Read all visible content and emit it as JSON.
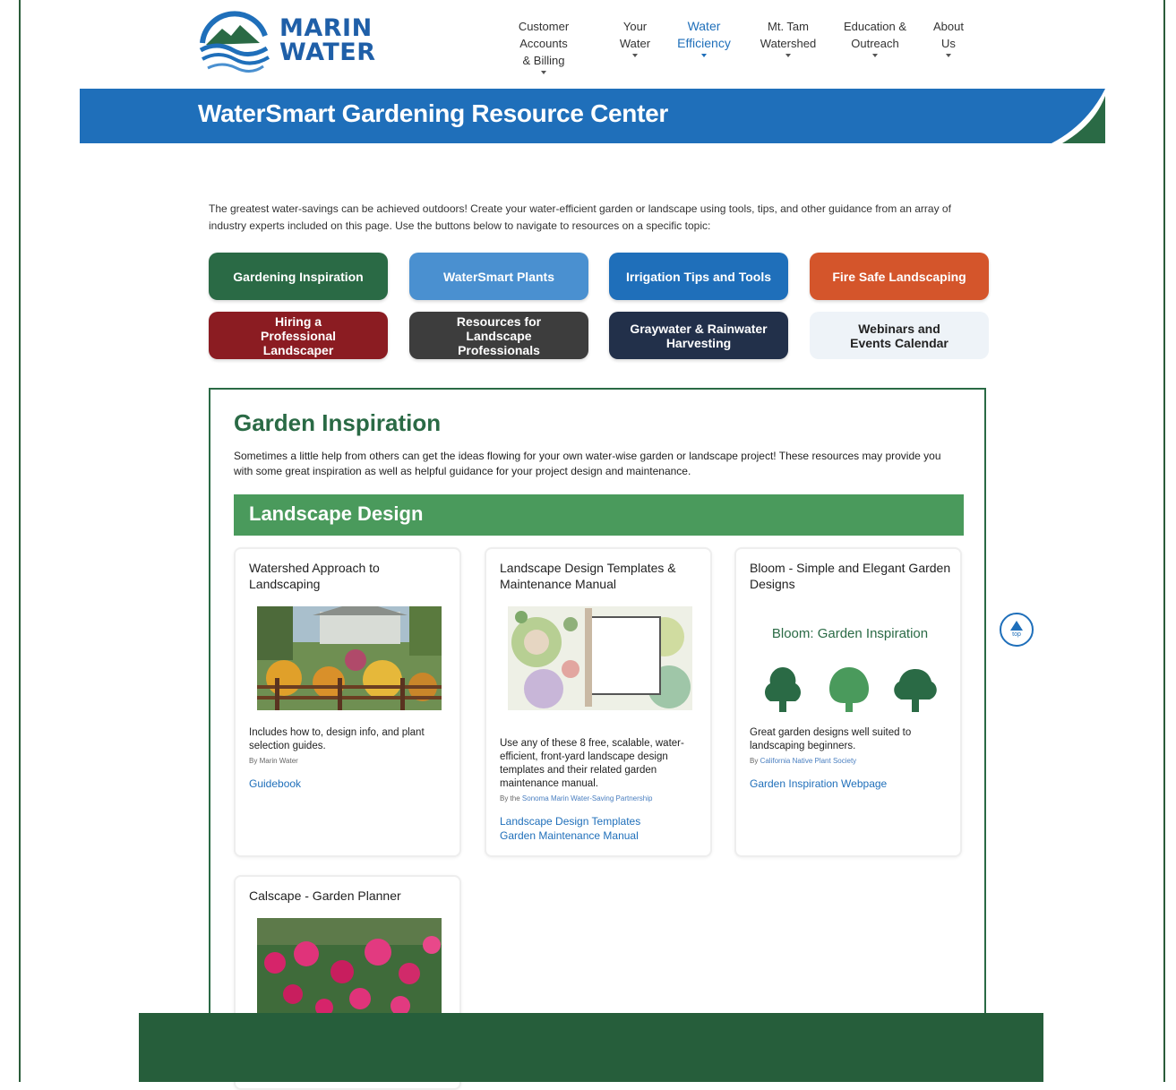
{
  "logo": {
    "line1": "MARIN",
    "line2": "WATER"
  },
  "nav": [
    {
      "line1": "Customer Accounts",
      "line2": "& Billing"
    },
    {
      "line1": "Your",
      "line2": "Water"
    },
    {
      "line1": "Water",
      "line2": "Efficiency"
    },
    {
      "line1": "Mt. Tam",
      "line2": "Watershed"
    },
    {
      "line1": "Education &",
      "line2": "Outreach"
    },
    {
      "line1": "About",
      "line2": "Us"
    }
  ],
  "banner": {
    "title": "WaterSmart Gardening Resource Center"
  },
  "intro": "The greatest water-savings can be achieved outdoors! Create your water-efficient garden or landscape using tools, tips, and other guidance from an array of industry experts included on this page. Use the buttons below to navigate to resources on a specific topic:",
  "buttons": [
    {
      "label": "Gardening Inspiration",
      "color": "#2a6a45"
    },
    {
      "label": "WaterSmart Plants",
      "color": "#4a90d0"
    },
    {
      "label": "Irrigation Tips and Tools",
      "color": "#1f6fba"
    },
    {
      "label": "Fire Safe Landscaping",
      "color": "#d4552b"
    },
    {
      "label": "Hiring a Professional Landscaper",
      "color": "#8b1c22"
    },
    {
      "label": "Resources for Landscape Professionals",
      "color": "#3d3d3d"
    },
    {
      "label": "Graywater & Rainwater Harvesting",
      "color": "#22304a"
    },
    {
      "label": "Webinars and Events Calendar",
      "color": "#eef3f8"
    }
  ],
  "section": {
    "title": "Garden Inspiration",
    "description": "Sometimes a little help from others can get the ideas flowing for your own water-wise garden or landscape project! These resources may provide you with some great inspiration as well as helpful guidance for your project design and maintenance.",
    "subheader": "Landscape Design"
  },
  "cards": [
    {
      "title": "Watershed Approach to Landscaping",
      "description": "Includes how to, design info, and plant selection guides.",
      "by_prefix": "By",
      "by_org": "Marin Water",
      "links": [
        "Guidebook"
      ]
    },
    {
      "title": "Landscape Design Templates & Maintenance Manual",
      "description": "Use any of these 8 free, scalable, water-efficient, front-yard landscape design templates and their related garden maintenance manual.",
      "by_prefix": "By the",
      "by_org": "Sonoma Marin Water-Saving Partnership",
      "links": [
        "Landscape Design Templates",
        "Garden Maintenance Manual"
      ]
    },
    {
      "title": "Bloom - Simple and Elegant Garden Designs",
      "image_heading": "Bloom: Garden Inspiration",
      "description": "Great garden designs well suited to landscaping beginners.",
      "by_prefix": "By",
      "by_org": "California Native Plant Society",
      "links": [
        "Garden Inspiration Webpage"
      ]
    },
    {
      "title": "Calscape - Garden Planner"
    }
  ],
  "top_button": {
    "label": "top"
  },
  "colors": {
    "brand_blue": "#1f6fba",
    "brand_green": "#2a6a45",
    "subheader_green": "#4a9a5c",
    "footer_green": "#265e3b"
  }
}
